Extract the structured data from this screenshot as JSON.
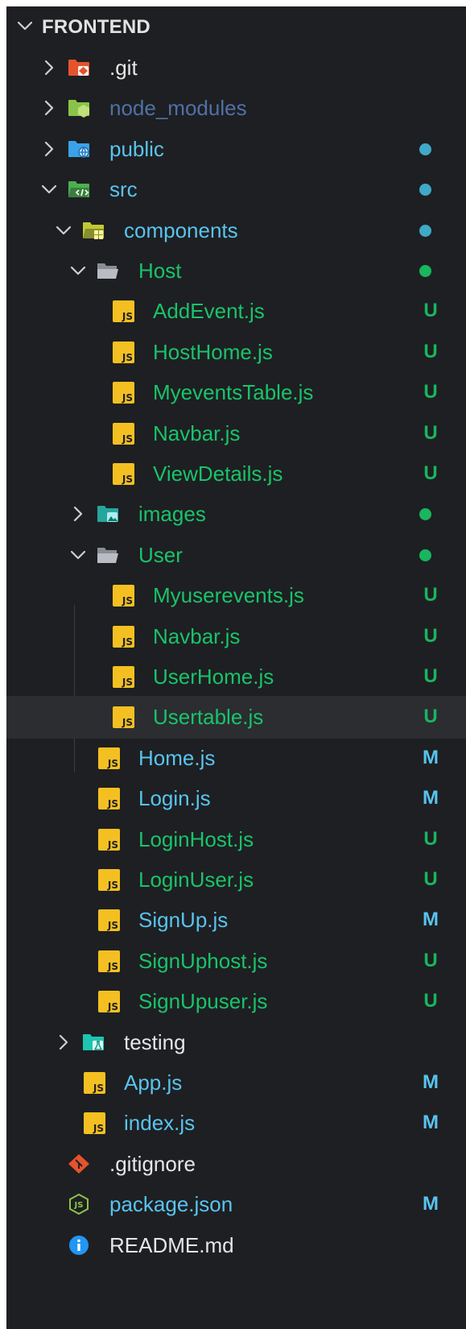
{
  "explorer": {
    "root_label": "FRONTEND",
    "items": [
      {
        "label": ".git",
        "icon": "git-folder-icon",
        "indent": 0,
        "chevron": "collapsed",
        "color": "#e6e6e6",
        "status": "",
        "dot": ""
      },
      {
        "label": "node_modules",
        "icon": "node-folder-icon",
        "indent": 0,
        "chevron": "collapsed",
        "color": "#4f71a8",
        "status": "",
        "dot": ""
      },
      {
        "label": "public",
        "icon": "public-folder-icon",
        "indent": 0,
        "chevron": "collapsed",
        "color": "#58c4ef",
        "status": "",
        "dot": "#3fa9c7"
      },
      {
        "label": "src",
        "icon": "src-folder-icon",
        "indent": 0,
        "chevron": "expanded",
        "color": "#58c4ef",
        "status": "",
        "dot": "#3fa9c7"
      },
      {
        "label": "components",
        "icon": "components-folder-icon",
        "indent": 1,
        "chevron": "expanded",
        "color": "#58c4ef",
        "status": "",
        "dot": "#3fa9c7"
      },
      {
        "label": "Host",
        "icon": "folder-open-icon",
        "indent": 2,
        "chevron": "expanded",
        "color": "#19c36a",
        "status": "",
        "dot": "#19b55f"
      },
      {
        "label": "AddEvent.js",
        "icon": "js-file-icon",
        "indent": 3,
        "chevron": "",
        "color": "#19c36a",
        "status": "U",
        "dot": ""
      },
      {
        "label": "HostHome.js",
        "icon": "js-file-icon",
        "indent": 3,
        "chevron": "",
        "color": "#19c36a",
        "status": "U",
        "dot": ""
      },
      {
        "label": "MyeventsTable.js",
        "icon": "js-file-icon",
        "indent": 3,
        "chevron": "",
        "color": "#19c36a",
        "status": "U",
        "dot": ""
      },
      {
        "label": "Navbar.js",
        "icon": "js-file-icon",
        "indent": 3,
        "chevron": "",
        "color": "#19c36a",
        "status": "U",
        "dot": ""
      },
      {
        "label": "ViewDetails.js",
        "icon": "js-file-icon",
        "indent": 3,
        "chevron": "",
        "color": "#19c36a",
        "status": "U",
        "dot": ""
      },
      {
        "label": "images",
        "icon": "images-folder-icon",
        "indent": 2,
        "chevron": "collapsed",
        "color": "#19c36a",
        "status": "",
        "dot": "#19b55f"
      },
      {
        "label": "User",
        "icon": "folder-open-icon",
        "indent": 2,
        "chevron": "expanded",
        "color": "#19c36a",
        "status": "",
        "dot": "#19b55f"
      },
      {
        "label": "Myuserevents.js",
        "icon": "js-file-icon",
        "indent": 3,
        "chevron": "",
        "color": "#19c36a",
        "status": "U",
        "dot": ""
      },
      {
        "label": "Navbar.js",
        "icon": "js-file-icon",
        "indent": 3,
        "chevron": "",
        "color": "#19c36a",
        "status": "U",
        "dot": ""
      },
      {
        "label": "UserHome.js",
        "icon": "js-file-icon",
        "indent": 3,
        "chevron": "",
        "color": "#19c36a",
        "status": "U",
        "dot": ""
      },
      {
        "label": "Usertable.js",
        "icon": "js-file-icon",
        "indent": 3,
        "chevron": "",
        "color": "#19c36a",
        "status": "U",
        "dot": "",
        "selected": true
      },
      {
        "label": "Home.js",
        "icon": "js-file-icon",
        "indent": 2,
        "chevron": "",
        "color": "#58c4ef",
        "status": "M",
        "dot": ""
      },
      {
        "label": "Login.js",
        "icon": "js-file-icon",
        "indent": 2,
        "chevron": "",
        "color": "#58c4ef",
        "status": "M",
        "dot": ""
      },
      {
        "label": "LoginHost.js",
        "icon": "js-file-icon",
        "indent": 2,
        "chevron": "",
        "color": "#19c36a",
        "status": "U",
        "dot": ""
      },
      {
        "label": "LoginUser.js",
        "icon": "js-file-icon",
        "indent": 2,
        "chevron": "",
        "color": "#19c36a",
        "status": "U",
        "dot": ""
      },
      {
        "label": "SignUp.js",
        "icon": "js-file-icon",
        "indent": 2,
        "chevron": "",
        "color": "#58c4ef",
        "status": "M",
        "dot": ""
      },
      {
        "label": "SignUphost.js",
        "icon": "js-file-icon",
        "indent": 2,
        "chevron": "",
        "color": "#19c36a",
        "status": "U",
        "dot": ""
      },
      {
        "label": "SignUpuser.js",
        "icon": "js-file-icon",
        "indent": 2,
        "chevron": "",
        "color": "#19c36a",
        "status": "U",
        "dot": ""
      },
      {
        "label": "testing",
        "icon": "testing-folder-icon",
        "indent": 1,
        "chevron": "collapsed",
        "color": "#e6e6e6",
        "status": "",
        "dot": ""
      },
      {
        "label": "App.js",
        "icon": "js-file-icon",
        "indent": 1,
        "chevron": "",
        "color": "#58c4ef",
        "status": "M",
        "dot": ""
      },
      {
        "label": "index.js",
        "icon": "js-file-icon",
        "indent": 1,
        "chevron": "",
        "color": "#58c4ef",
        "status": "M",
        "dot": ""
      },
      {
        "label": ".gitignore",
        "icon": "git-icon",
        "indent": 0,
        "chevron": "",
        "color": "#e6e6e6",
        "status": "",
        "dot": ""
      },
      {
        "label": "package.json",
        "icon": "node-json-icon",
        "indent": 0,
        "chevron": "",
        "color": "#58c4ef",
        "status": "M",
        "dot": ""
      },
      {
        "label": "README.md",
        "icon": "info-icon",
        "indent": 0,
        "chevron": "",
        "color": "#e6e6e6",
        "status": "",
        "dot": ""
      }
    ],
    "status_colors": {
      "U": "#19b55f",
      "M": "#58c4ef"
    }
  }
}
